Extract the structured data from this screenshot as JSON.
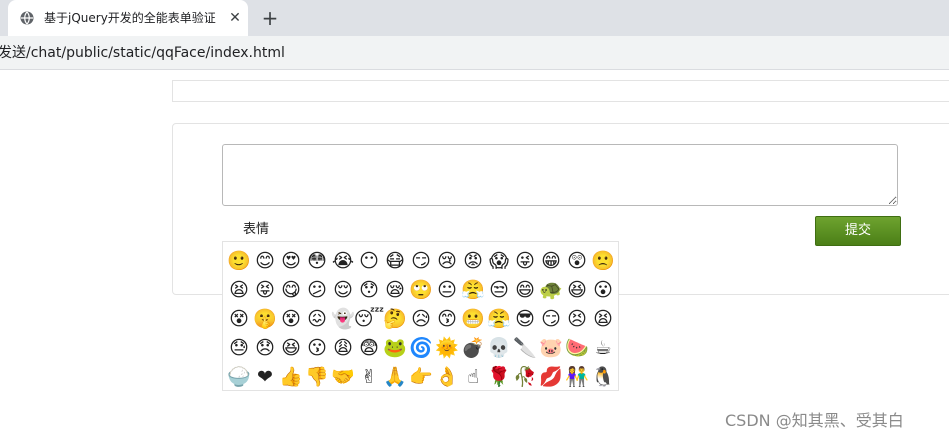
{
  "browser": {
    "tab_title": "基于jQuery开发的全能表单验证",
    "close_glyph": "✕",
    "new_tab_glyph": "+",
    "url": "发送/chat/public/static/qqFace/index.html"
  },
  "form": {
    "emotion_label": "表情",
    "submit_label": "提交"
  },
  "faces": [
    "🙂",
    "😊",
    "😍",
    "😳",
    "😭",
    "😶",
    "😷",
    "😏",
    "😢",
    "😡",
    "😱",
    "😜",
    "😁",
    "😲",
    "🙁",
    "😫",
    "😝",
    "😋",
    "😕",
    "😌",
    "😯",
    "😪",
    "🙄",
    "😐",
    "😤",
    "😒",
    "😄",
    "🐢",
    "😆",
    "😮",
    "😵",
    "🤫",
    "😵",
    "😖",
    "👻",
    "😴",
    "🤔",
    "😥",
    "😙",
    "😬",
    "😤",
    "😎",
    "😏",
    "😣",
    "😫",
    "😓",
    "😞",
    "😆",
    "😗",
    "😩",
    "😨",
    "🐸",
    "🌀",
    "🌞",
    "💣",
    "💀",
    "🔪",
    "🐷",
    "🍉",
    "☕",
    "🍚",
    "❤",
    "👍",
    "👎",
    "🤝",
    "✌",
    "🙏",
    "👉",
    "👌",
    "☝",
    "🌹",
    "🥀",
    "💋",
    "👫",
    "🐧"
  ],
  "watermark": "CSDN @知其黑、受其白"
}
